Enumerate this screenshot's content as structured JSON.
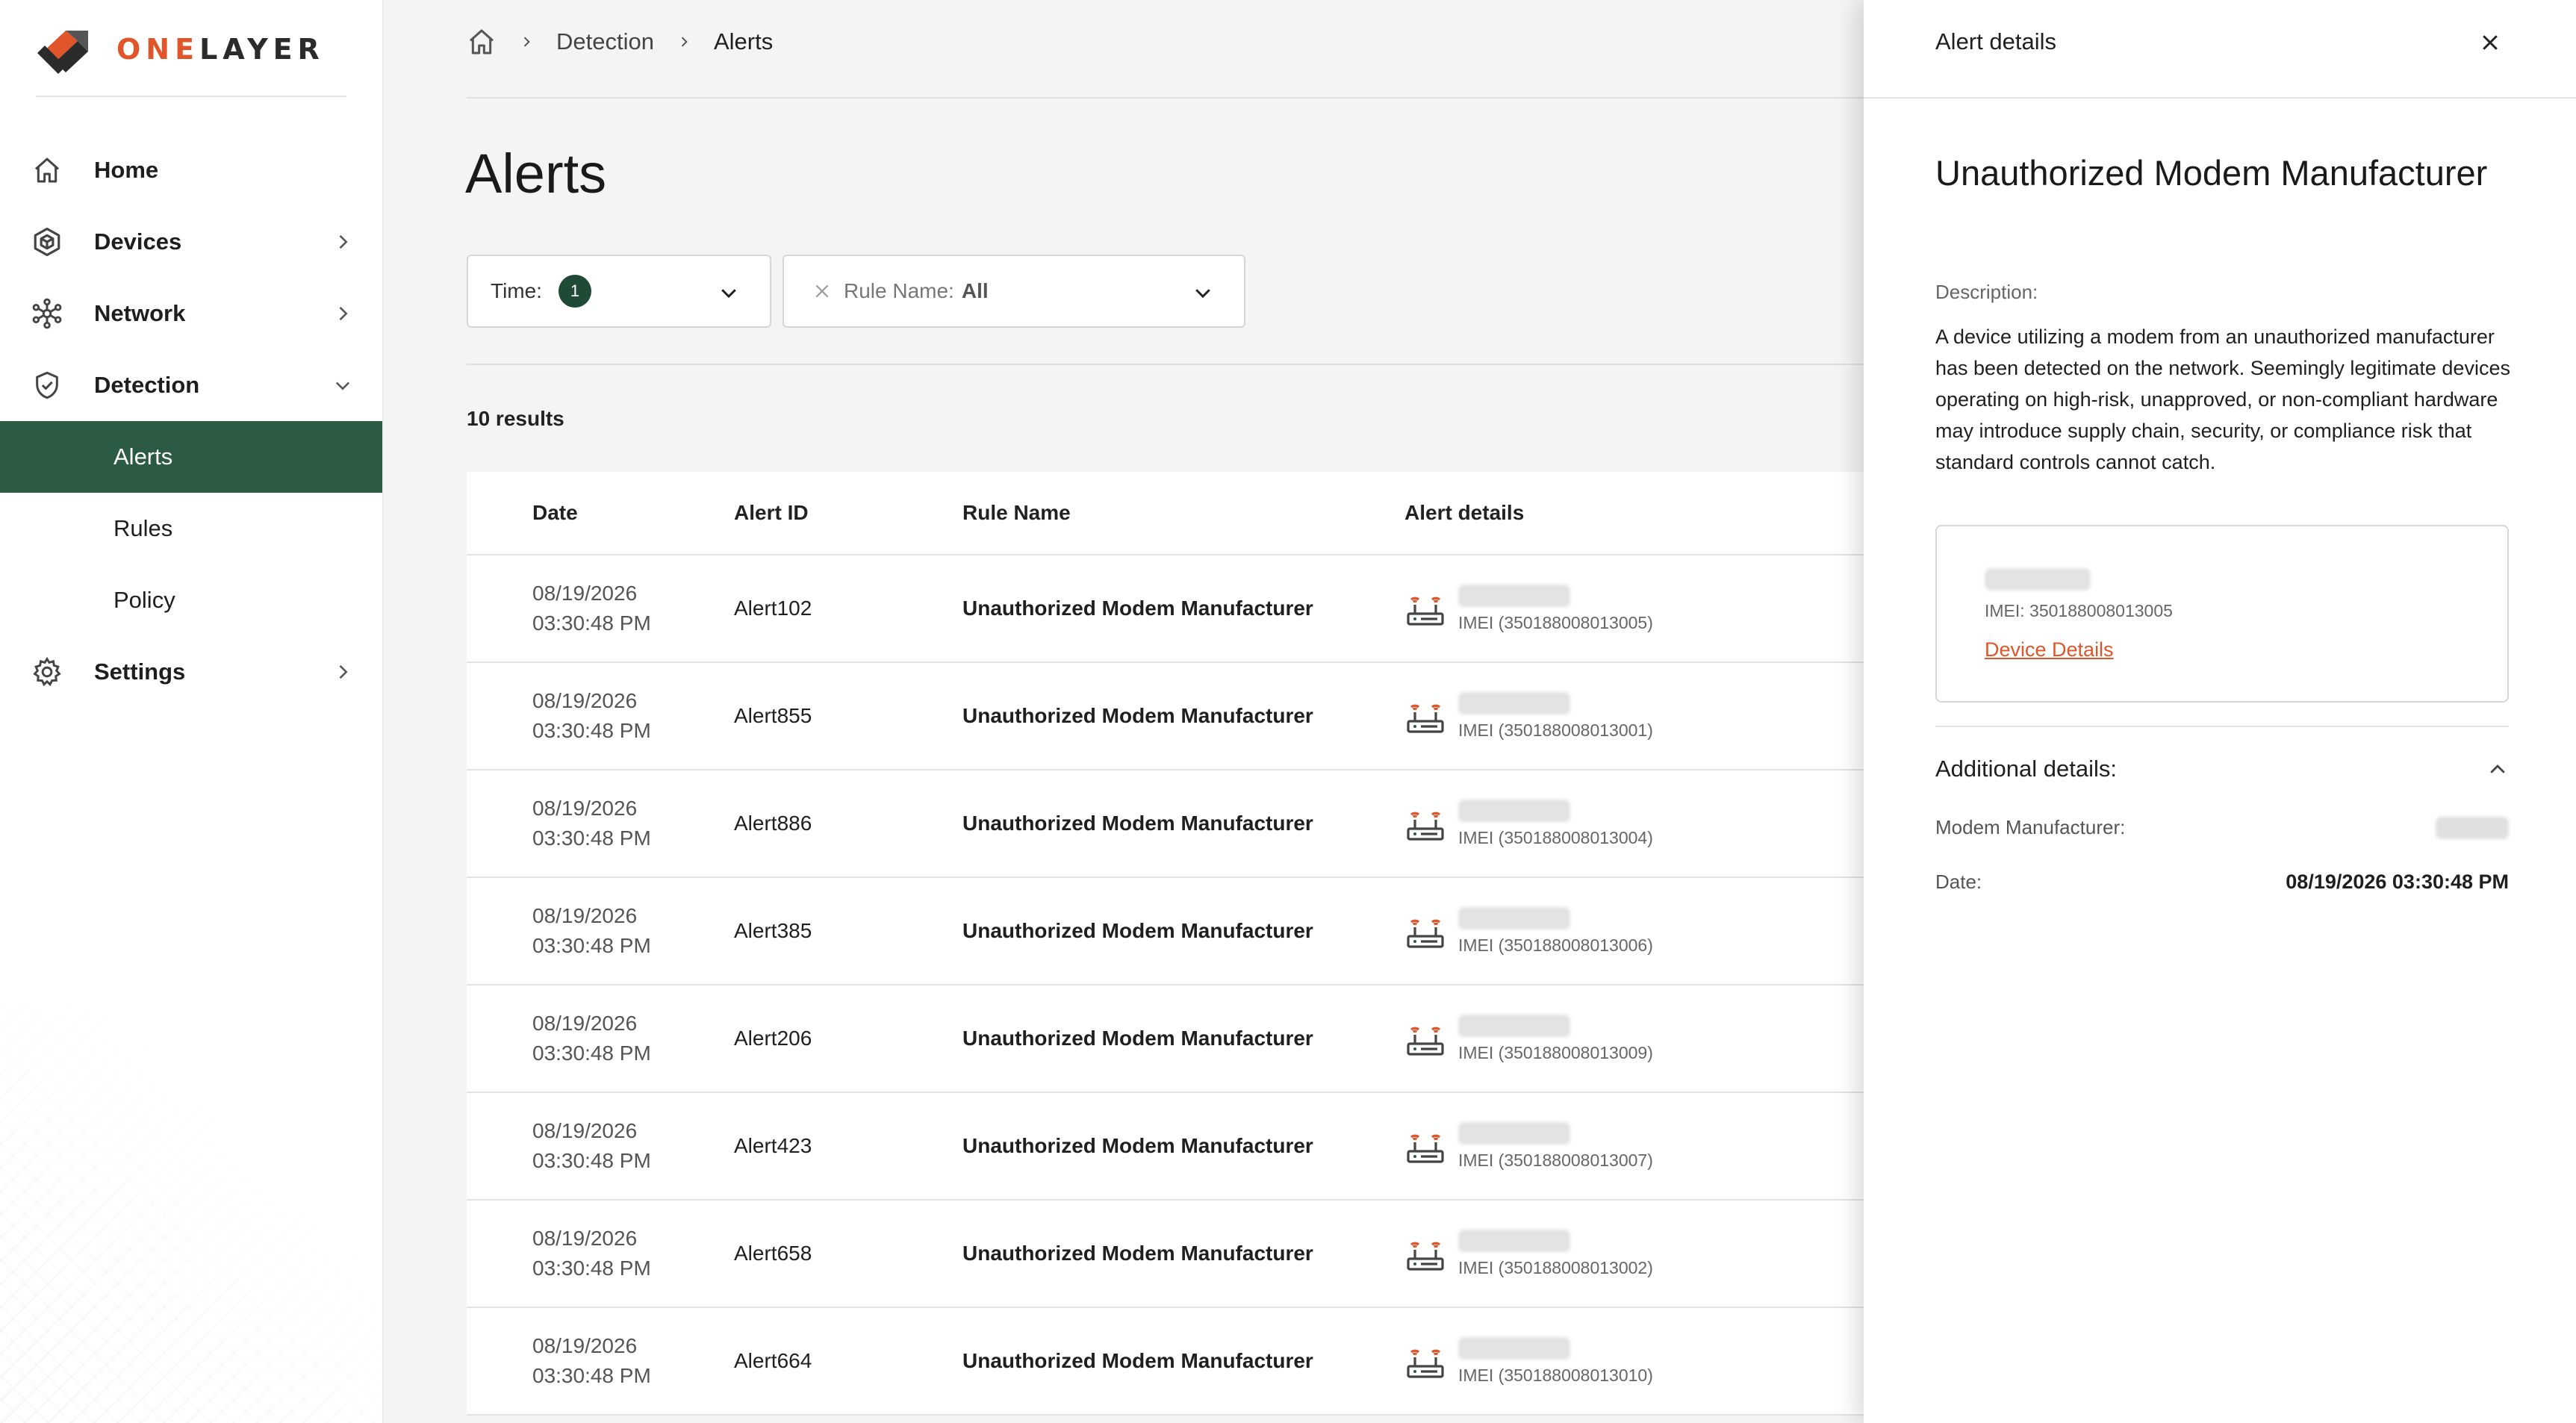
{
  "brand": {
    "name_part1": "ONE",
    "name_part2": "LAYER",
    "accent": "#e0562a",
    "primary": "#2c5b43"
  },
  "sidebar": {
    "items": [
      {
        "label": "Home",
        "icon": "home-icon"
      },
      {
        "label": "Devices",
        "icon": "devices-icon"
      },
      {
        "label": "Network",
        "icon": "network-icon"
      },
      {
        "label": "Detection",
        "icon": "shield-icon"
      },
      {
        "label": "Settings",
        "icon": "gear-icon"
      }
    ],
    "detection_sub": [
      {
        "label": "Alerts",
        "active": true
      },
      {
        "label": "Rules",
        "active": false
      },
      {
        "label": "Policy",
        "active": false
      }
    ]
  },
  "breadcrumb": {
    "items": [
      "Detection",
      "Alerts"
    ]
  },
  "page": {
    "title": "Alerts"
  },
  "filters": {
    "time_label": "Time:",
    "time_count": "1",
    "rule_label": "Rule Name:",
    "rule_value": "All"
  },
  "results": "10 results",
  "table": {
    "headers": [
      "Date",
      "Alert ID",
      "Rule Name",
      "Alert details"
    ],
    "rows": [
      {
        "date": "08/19/2026",
        "time": "03:30:48 PM",
        "id": "Alert102",
        "rule": "Unauthorized Modem Manufacturer",
        "imei": "IMEI (350188008013005)"
      },
      {
        "date": "08/19/2026",
        "time": "03:30:48 PM",
        "id": "Alert855",
        "rule": "Unauthorized Modem Manufacturer",
        "imei": "IMEI (350188008013001)"
      },
      {
        "date": "08/19/2026",
        "time": "03:30:48 PM",
        "id": "Alert886",
        "rule": "Unauthorized Modem Manufacturer",
        "imei": "IMEI (350188008013004)"
      },
      {
        "date": "08/19/2026",
        "time": "03:30:48 PM",
        "id": "Alert385",
        "rule": "Unauthorized Modem Manufacturer",
        "imei": "IMEI (350188008013006)"
      },
      {
        "date": "08/19/2026",
        "time": "03:30:48 PM",
        "id": "Alert206",
        "rule": "Unauthorized Modem Manufacturer",
        "imei": "IMEI (350188008013009)"
      },
      {
        "date": "08/19/2026",
        "time": "03:30:48 PM",
        "id": "Alert423",
        "rule": "Unauthorized Modem Manufacturer",
        "imei": "IMEI (350188008013007)"
      },
      {
        "date": "08/19/2026",
        "time": "03:30:48 PM",
        "id": "Alert658",
        "rule": "Unauthorized Modem Manufacturer",
        "imei": "IMEI (350188008013002)"
      },
      {
        "date": "08/19/2026",
        "time": "03:30:48 PM",
        "id": "Alert664",
        "rule": "Unauthorized Modem Manufacturer",
        "imei": "IMEI (350188008013010)"
      }
    ]
  },
  "drawer": {
    "title": "Alert details",
    "alert_name": "Unauthorized Modem Manufacturer",
    "description_label": "Description:",
    "description": "A device utilizing a modem from an unauthorized manufacturer has been detected on the network. Seemingly legitimate devices operating on high-risk, unapproved, or non-compliant hardware may introduce supply chain, security, or compliance risk that standard controls cannot catch.",
    "device_imei": "IMEI: 350188008013005",
    "device_link": "Device Details",
    "additional_header": "Additional details:",
    "modem_label": "Modem Manufacturer:",
    "date_label": "Date:",
    "date_value": "08/19/2026 03:30:48 PM"
  }
}
